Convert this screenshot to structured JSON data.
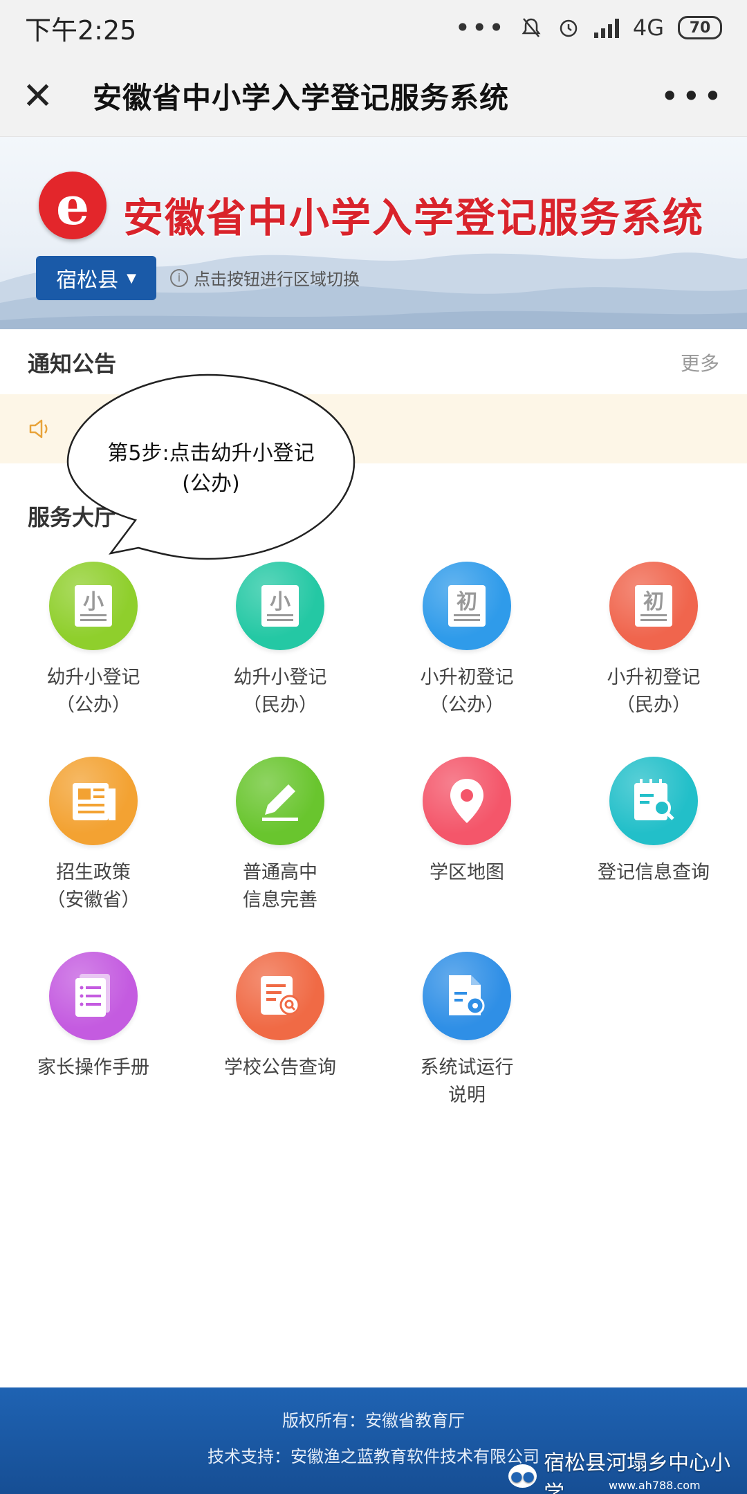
{
  "status_bar": {
    "time": "下午2:25",
    "network": "4G",
    "battery": "70"
  },
  "title_bar": {
    "title": "安徽省中小学入学登记服务系统"
  },
  "banner": {
    "title": "安徽省中小学入学登记服务系统",
    "logo_icon": "e-logo-icon",
    "region_button": "宿松县",
    "hint": "点击按钮进行区域切换"
  },
  "notice": {
    "heading": "通知公告",
    "more": "更多"
  },
  "services": {
    "heading": "服务大厅",
    "items": [
      {
        "line1": "幼升小登记",
        "line2": "（公办）",
        "glyph": "小",
        "color": "#8fcf2c"
      },
      {
        "line1": "幼升小登记",
        "line2": "（民办）",
        "glyph": "小",
        "color": "#24c8a4"
      },
      {
        "line1": "小升初登记",
        "line2": "（公办）",
        "glyph": "初",
        "color": "#2f9bea"
      },
      {
        "line1": "小升初登记",
        "line2": "（民办）",
        "glyph": "初",
        "color": "#f0654d"
      },
      {
        "line1": "招生政策",
        "line2": "（安徽省）",
        "glyph": "news",
        "color": "#f3a232"
      },
      {
        "line1": "普通高中",
        "line2": "信息完善",
        "glyph": "edit",
        "color": "#69c52e"
      },
      {
        "line1": "学区地图",
        "line2": "",
        "glyph": "pin",
        "color": "#f4566a"
      },
      {
        "line1": "登记信息查询",
        "line2": "",
        "glyph": "search",
        "color": "#22bfc9"
      },
      {
        "line1": "家长操作手册",
        "line2": "",
        "glyph": "doc",
        "color": "#c45be0"
      },
      {
        "line1": "学校公告查询",
        "line2": "",
        "glyph": "notice",
        "color": "#f06a45"
      },
      {
        "line1": "系统试运行",
        "line2": "说明",
        "glyph": "gear",
        "color": "#2f8fe6"
      }
    ]
  },
  "callout": {
    "text": "第5步:点击幼升小登记(公办)"
  },
  "footer": {
    "copyright": "版权所有：安徽省教育厅",
    "support": "技术支持：安徽渔之蓝教育软件技术有限公司"
  },
  "watermark": {
    "account": "宿松县河塌乡中心小学",
    "site": "www.ah788.com"
  }
}
